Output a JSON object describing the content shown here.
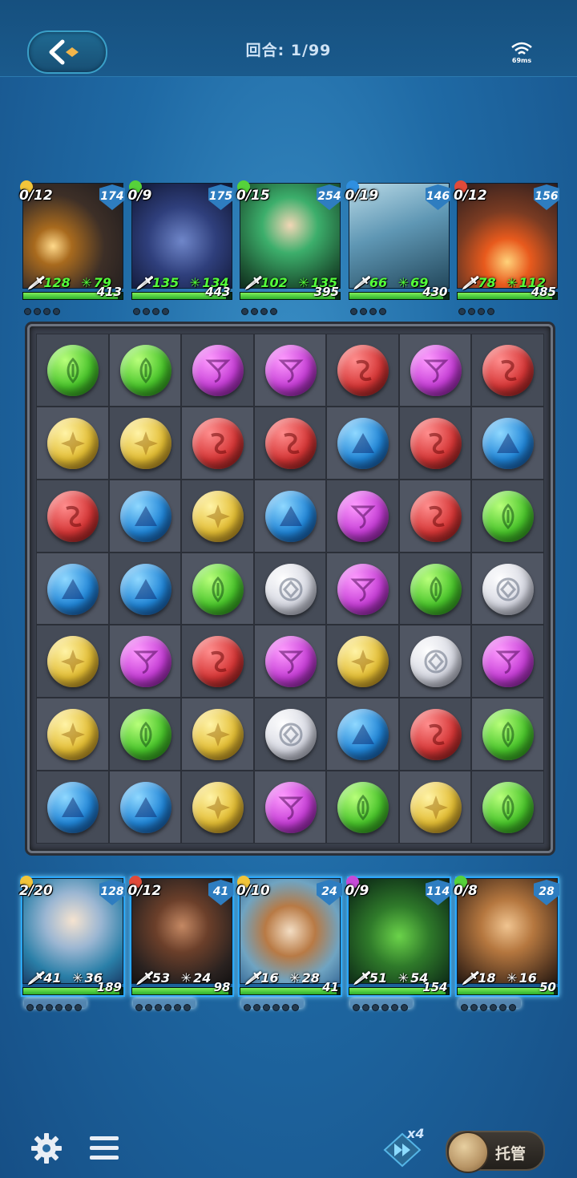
{
  "header": {
    "back_icon": "back-arrow-icon",
    "round_label": "回合: 1/99",
    "ping": "69ms",
    "wifi_icon": "wifi-icon"
  },
  "enemies": [
    {
      "charge": "0/12",
      "shield": "174",
      "atk": "128",
      "mag": "79",
      "hp": "413",
      "hp_frac": 0.95,
      "element": "yellow",
      "art": "mech"
    },
    {
      "charge": "0/9",
      "shield": "175",
      "atk": "135",
      "mag": "134",
      "hp": "443",
      "hp_frac": 0.95,
      "element": "green",
      "art": "wolf"
    },
    {
      "charge": "0/15",
      "shield": "254",
      "atk": "102",
      "mag": "135",
      "hp": "395",
      "hp_frac": 0.95,
      "element": "green",
      "art": "elf"
    },
    {
      "charge": "0/19",
      "shield": "146",
      "atk": "66",
      "mag": "69",
      "hp": "430",
      "hp_frac": 0.95,
      "element": "blue",
      "art": "wave"
    },
    {
      "charge": "0/12",
      "shield": "156",
      "atk": "78",
      "mag": "112",
      "hp": "485",
      "hp_frac": 0.95,
      "element": "red",
      "art": "fire"
    }
  ],
  "board": [
    [
      "green",
      "green",
      "purple",
      "purple",
      "red",
      "purple",
      "red"
    ],
    [
      "yellow",
      "yellow",
      "red",
      "red",
      "blue",
      "red",
      "blue"
    ],
    [
      "red",
      "blue",
      "yellow",
      "blue",
      "purple",
      "red",
      "green"
    ],
    [
      "blue",
      "blue",
      "green",
      "white",
      "purple",
      "green",
      "white"
    ],
    [
      "yellow",
      "purple",
      "red",
      "purple",
      "yellow",
      "white",
      "purple"
    ],
    [
      "yellow",
      "green",
      "yellow",
      "white",
      "blue",
      "red",
      "green"
    ],
    [
      "blue",
      "blue",
      "yellow",
      "purple",
      "green",
      "yellow",
      "green"
    ]
  ],
  "party": [
    {
      "charge": "2/20",
      "shield": "128",
      "atk": "41",
      "mag": "36",
      "hp": "189",
      "hp_frac": 0.97,
      "element": "yellow",
      "art": "sorceress"
    },
    {
      "charge": "0/12",
      "shield": "41",
      "atk": "53",
      "mag": "24",
      "hp": "98",
      "hp_frac": 0.97,
      "element": "red",
      "art": "warrior"
    },
    {
      "charge": "0/10",
      "shield": "24",
      "atk": "16",
      "mag": "28",
      "hp": "41",
      "hp_frac": 0.97,
      "element": "yellow",
      "art": "squirrel"
    },
    {
      "charge": "0/9",
      "shield": "114",
      "atk": "51",
      "mag": "54",
      "hp": "154",
      "hp_frac": 0.97,
      "element": "purple",
      "art": "spider"
    },
    {
      "charge": "0/8",
      "shield": "28",
      "atk": "18",
      "mag": "16",
      "hp": "50",
      "hp_frac": 0.97,
      "element": "green",
      "art": "hunter"
    }
  ],
  "footer": {
    "settings_icon": "gear-icon",
    "menu_icon": "hamburger-menu-icon",
    "speed_label": "x4",
    "speed_icon": "fast-forward-icon",
    "auto_label": "托管"
  },
  "colors": {
    "green": "#49c52b",
    "purple": "#c63ed6",
    "red": "#d63636",
    "yellow": "#e3bd33",
    "blue": "#2186d8",
    "white": "#d6d8e2"
  }
}
